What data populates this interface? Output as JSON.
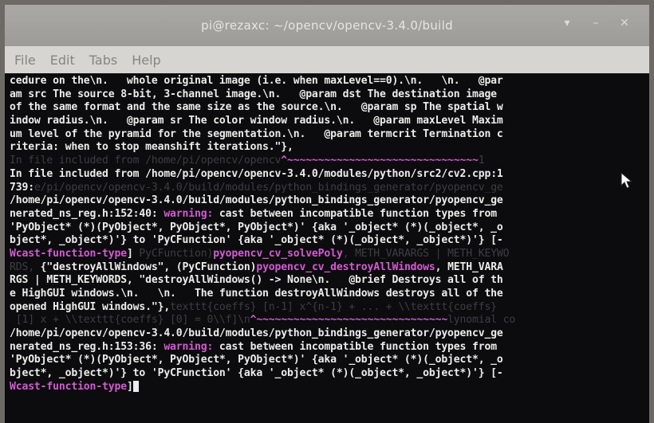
{
  "window": {
    "title": "pi@rezaxc: ~/opencv/opencv-3.4.0/build",
    "controls": [
      "▾",
      "–",
      "✕"
    ]
  },
  "menu": [
    "File",
    "Edit",
    "Tabs",
    "Help"
  ],
  "terminal": {
    "lines": [
      [
        {
          "t": "cedure on the\\n.   whole original image (i.e. when maxLevel==0).\\n.   \\n.   @par"
        }
      ],
      [
        {
          "t": "am src The source 8-bit, 3-channel image.\\n.   @param dst The destination image"
        }
      ],
      [
        {
          "t": "of the same format and the same size as the source.\\n.   @param sp The spatial w"
        }
      ],
      [
        {
          "t": "indow radius.\\n.   @param sr The color window radius.\\n.   @param maxLevel Maxim"
        }
      ],
      [
        {
          "t": "um level of the pyramid for the segmentation.\\n.   @param termcrit Termination c"
        }
      ],
      [
        {
          "t": "riteria: when to stop meanshift iterations.\"},"
        }
      ],
      [
        {
          "t": "In file included from /home/pi/opencv/opencv",
          "c": "dim"
        },
        {
          "t": "^~~~~~~~~~~~~~~~~~~~~~~~~~~~~~~~",
          "c": "magenta"
        },
        {
          "t": "1",
          "c": "dim"
        }
      ],
      [
        {
          "t": "In file included from "
        },
        {
          "t": "/home/pi/opencv/opencv-3.4.0/modules/python/src2/cv2.cpp:1"
        }
      ],
      [
        {
          "t": "739:"
        },
        {
          "t": "e/pi/opencv/opencv-3.4.0/build/modules/python_bindings_generator/pyopencv_ge",
          "c": "dim"
        }
      ],
      [
        {
          "t": "/home/pi/opencv/opencv-3.4.0/build/modules/python_bindings_generator/pyopencv_ge"
        }
      ],
      [
        {
          "t": "nerated_ns_reg.h:152:40: "
        },
        {
          "t": "warning:",
          "c": "magenta"
        },
        {
          "t": " cast between incompatible function types from"
        }
      ],
      [
        {
          "t": "'PyObject* (*)(PyObject*, PyObject*, PyObject*)' {aka '_object* (*)(_object*, _o"
        }
      ],
      [
        {
          "t": "bject*, _object*)'} to 'PyCFunction' {aka '_object* (*)(_object*, _object*)'} [-"
        }
      ],
      [
        {
          "t": "Wcast-function-type",
          "c": "magenta"
        },
        {
          "t": "]"
        },
        {
          "t": " PyCFunction)",
          "c": "dim"
        },
        {
          "t": "pyopencv_cv_solvePoly",
          "c": "magenta"
        },
        {
          "t": ", METH_VARARGS | METH_KEYWO",
          "c": "dim"
        }
      ],
      [
        {
          "t": "RDS, ",
          "c": "dim"
        },
        {
          "t": "{\"destroyAllWindows\", (PyCFunction)"
        },
        {
          "t": "pyopencv_cv_destroyAllWindows",
          "c": "magenta"
        },
        {
          "t": ", METH_VARA"
        }
      ],
      [
        {
          "t": "RGS | METH_KEYWORDS, \"destroyAllWindows() -> None\\n.   @brief Destroys all of th"
        }
      ],
      [
        {
          "t": "e HighGUI windows.\\n.   \\n.   The function destroyAllWindows destroys all of the"
        }
      ],
      [
        {
          "t": "opened HighGUI windows.\"},"
        },
        {
          "t": "texttt{coeffs} [n-1] x^{n-1} + ... + \\\\texttt{coeffs}",
          "c": "dim"
        }
      ],
      [
        {
          "t": " [1] x + \\\\texttt{coeffs} [0] = 0\\\\f]\\n",
          "c": "dim"
        },
        {
          "t": "^~~~~~~~~~~~~~~~~~~~~~~~~~~~~~~~",
          "c": "magenta"
        },
        {
          "t": "lynomial co",
          "c": "dim"
        }
      ],
      [
        {
          "t": "/home/pi/opencv/opencv-3.4.0/build/modules/python_bindings_generator/pyopencv_ge"
        }
      ],
      [
        {
          "t": "nerated_ns_reg.h:153:36: "
        },
        {
          "t": "warning:",
          "c": "magenta"
        },
        {
          "t": " cast between incompatible function types from"
        }
      ],
      [
        {
          "t": "'PyObject* (*)(PyObject*, PyObject*, PyObject*)' {aka '_object* (*)(_object*, _o"
        }
      ],
      [
        {
          "t": "bject*, _object*)'} to 'PyCFunction' {aka '_object* (*)(_object*, _object*)'} [-"
        }
      ],
      [
        {
          "t": "Wcast-function-type",
          "c": "magenta"
        },
        {
          "t": "]"
        },
        {
          "t": "",
          "c": "cursor"
        }
      ]
    ]
  },
  "colors": {
    "background": "#0c0c0e",
    "text": "#ececec",
    "warning": "#d45ad2",
    "dim": "#3d3d44"
  }
}
